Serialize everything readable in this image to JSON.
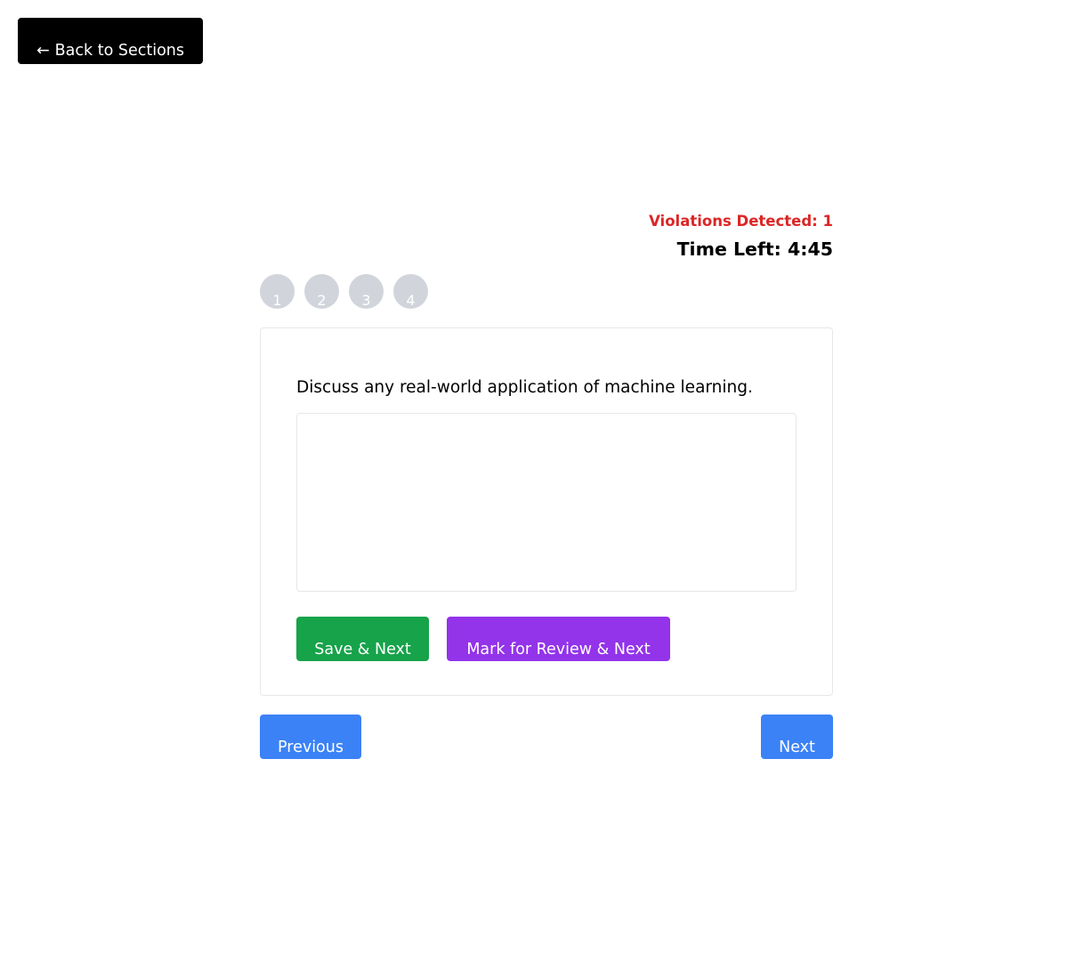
{
  "back_button": {
    "arrow": "←",
    "label": "Back to Sections"
  },
  "status": {
    "violations": "Violations Detected: 1",
    "time_left": "Time Left: 4:45"
  },
  "question_nav": [
    "1",
    "2",
    "3",
    "4"
  ],
  "question": {
    "text": "Discuss any real-world application of machine learning.",
    "answer_value": "",
    "answer_placeholder": ""
  },
  "actions": {
    "save_next": "Save & Next",
    "mark_review_next": "Mark for Review & Next"
  },
  "navigation": {
    "previous": "Previous",
    "next": "Next"
  },
  "colors": {
    "back_button_bg": "#000000",
    "violations_text": "#dc2626",
    "question_nav_bg": "#d1d5db",
    "save_button_bg": "#16a34a",
    "review_button_bg": "#9333ea",
    "nav_button_bg": "#3b82f6"
  }
}
